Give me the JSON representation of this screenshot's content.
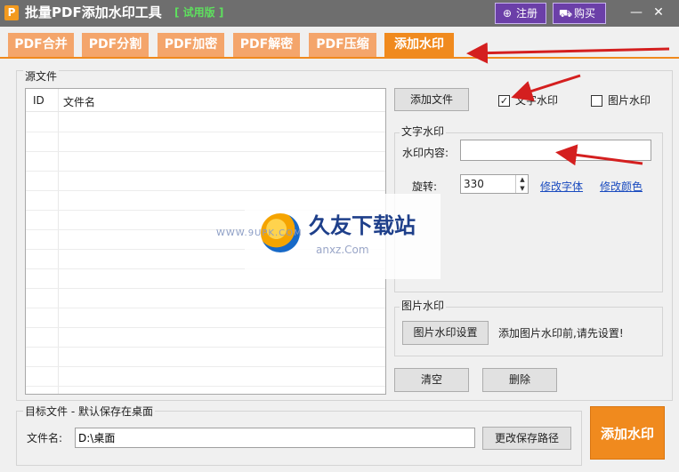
{
  "colors": {
    "accent": "#f08a1e",
    "tab_inactive": "#f4a56b",
    "titlebar": "#6e6e6e",
    "purple_button": "#6b3fa8",
    "arrow": "#d41f1f",
    "link": "#1a4bbf"
  },
  "titlebar": {
    "logo_letter": "P",
    "title": "批量PDF添加水印工具",
    "badge": "[ 试用版 ]",
    "register": {
      "icon": "plus-circle-icon",
      "label": "注册"
    },
    "buy": {
      "icon": "cart-icon",
      "label": "购买"
    },
    "minimize": "—",
    "close": "✕"
  },
  "tabs": [
    {
      "label": "PDF合并",
      "active": false
    },
    {
      "label": "PDF分割",
      "active": false
    },
    {
      "label": "PDF加密",
      "active": false
    },
    {
      "label": "PDF解密",
      "active": false
    },
    {
      "label": "PDF压缩",
      "active": false
    },
    {
      "label": "添加水印",
      "active": true
    }
  ],
  "source": {
    "legend": "源文件",
    "columns": [
      "ID",
      "文件名"
    ],
    "rows": []
  },
  "add_file_label": "添加文件",
  "text_wm_checkbox": {
    "label": "文字水印",
    "checked": true
  },
  "image_wm_checkbox": {
    "label": "图片水印",
    "checked": false
  },
  "text_wm": {
    "legend": "文字水印",
    "content_label": "水印内容:",
    "content_value": "",
    "rotate_label": "旋转:",
    "rotate_value": "330",
    "change_font": "修改字体",
    "change_color": "修改颜色"
  },
  "image_wm": {
    "legend": "图片水印",
    "settings_button": "图片水印设置",
    "hint": "添加图片水印前,请先设置!"
  },
  "clear_label": "清空",
  "delete_label": "删除",
  "target": {
    "legend": "目标文件 - 默认保存在桌面",
    "filename_label": "文件名:",
    "filename_value": "D:\\桌面",
    "change_path_label": "更改保存路径"
  },
  "add_watermark_label": "添加水印",
  "overlay": {
    "site_name": "久友下载站",
    "site_url": "anxz.Com",
    "site_www": "WWW.9UPK.COM"
  }
}
